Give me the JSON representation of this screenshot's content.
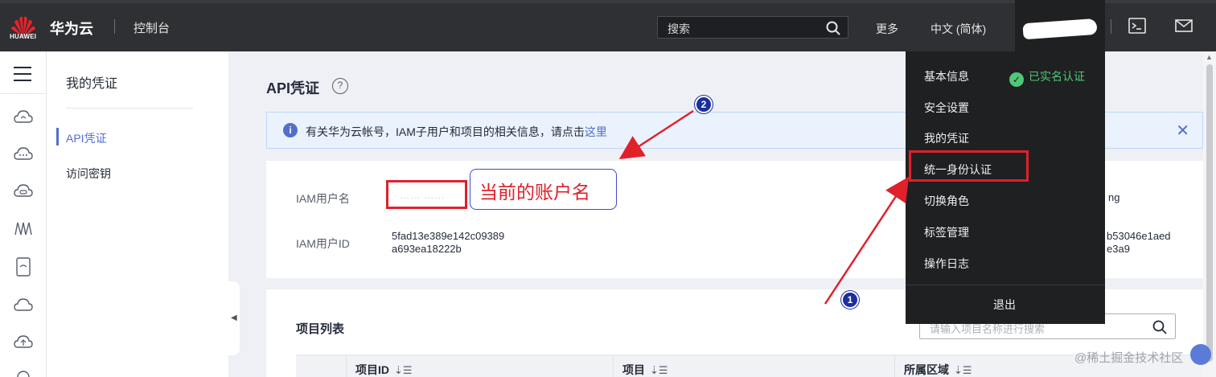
{
  "topbar": {
    "logo_text": "HUAWEI",
    "brand": "华为云",
    "console": "控制台",
    "search_placeholder": "搜索",
    "more": "更多",
    "language": "中文 (简体)"
  },
  "subnav": {
    "title": "我的凭证",
    "items": [
      {
        "label": "API凭证",
        "active": true
      },
      {
        "label": "访问密钥",
        "active": false
      }
    ]
  },
  "main": {
    "title": "API凭证",
    "info": {
      "text": "有关华为云帐号，IAM子用户和项目的相关信息，请点击",
      "link": "这里"
    },
    "credentials": {
      "username_label": "IAM用户名",
      "username_value": "…… ……",
      "userid_label": "IAM用户ID",
      "userid_line1": "5fad13e389e142c09389",
      "userid_line2": "a693ea18222b",
      "right_frag1": "ng",
      "right_frag2_line1": "b53046e1aed",
      "right_frag2_line2": "e3a9"
    },
    "projects": {
      "title": "项目列表",
      "search_placeholder": "请输入项目名称进行搜索",
      "columns": [
        "项目ID",
        "项目",
        "所属区域"
      ]
    }
  },
  "dropdown": {
    "items": [
      "基本信息",
      "安全设置",
      "我的凭证",
      "统一身份认证",
      "切换角色",
      "标签管理",
      "操作日志"
    ],
    "verified": "已实名认证",
    "logout": "退出"
  },
  "annotations": {
    "account_note": "当前的账户名",
    "badge1": "1",
    "badge2": "2"
  },
  "watermark": "@稀土掘金技术社区",
  "colors": {
    "topbar": "#2f3033",
    "accent": "#526ecc",
    "highlight": "#e0202a",
    "verified": "#50c878"
  }
}
